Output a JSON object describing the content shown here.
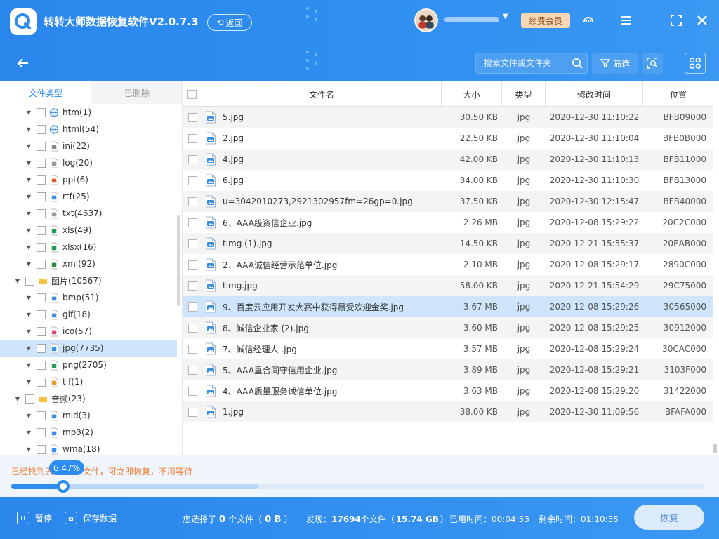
{
  "header": {
    "title": "转转大师数据恢复软件V2.0.7.3",
    "back_label": "返回",
    "vip_label": "续费会员"
  },
  "toolbar": {
    "search_placeholder": "搜索文件或文件夹",
    "filter_label": "筛选"
  },
  "sidebar": {
    "tabs": [
      {
        "label": "文件类型",
        "active": true
      },
      {
        "label": "已删除",
        "active": false
      }
    ],
    "tree": [
      {
        "level": 2,
        "label": "htm",
        "count": "(1)",
        "icon": "web-icon"
      },
      {
        "level": 2,
        "label": "html",
        "count": "(54)",
        "icon": "web-icon"
      },
      {
        "level": 2,
        "label": "ini",
        "count": "(22)",
        "icon": "config-file-icon"
      },
      {
        "level": 2,
        "label": "log",
        "count": "(20)",
        "icon": "text-file-icon"
      },
      {
        "level": 2,
        "label": "ppt",
        "count": "(6)",
        "icon": "ppt-file-icon"
      },
      {
        "level": 2,
        "label": "rtf",
        "count": "(25)",
        "icon": "rtf-file-icon"
      },
      {
        "level": 2,
        "label": "txt",
        "count": "(4637)",
        "icon": "text-file-icon"
      },
      {
        "level": 2,
        "label": "xls",
        "count": "(49)",
        "icon": "excel-file-icon"
      },
      {
        "level": 2,
        "label": "xlsx",
        "count": "(16)",
        "icon": "excel-file-icon"
      },
      {
        "level": 2,
        "label": "xml",
        "count": "(92)",
        "icon": "xml-file-icon"
      },
      {
        "level": 1,
        "label": "图片",
        "count": "(10567)",
        "icon": "folder-icon"
      },
      {
        "level": 2,
        "label": "bmp",
        "count": "(51)",
        "icon": "image-file-icon"
      },
      {
        "level": 2,
        "label": "gif",
        "count": "(18)",
        "icon": "image-file-icon"
      },
      {
        "level": 2,
        "label": "ico",
        "count": "(57)",
        "icon": "ico-file-icon"
      },
      {
        "level": 2,
        "label": "jpg",
        "count": "(7735)",
        "icon": "image-file-icon",
        "selected": true
      },
      {
        "level": 2,
        "label": "png",
        "count": "(2705)",
        "icon": "png-file-icon"
      },
      {
        "level": 2,
        "label": "tif",
        "count": "(1)",
        "icon": "tif-file-icon"
      },
      {
        "level": 1,
        "label": "音频",
        "count": "(23)",
        "icon": "folder-icon"
      },
      {
        "level": 2,
        "label": "mid",
        "count": "(3)",
        "icon": "audio-file-icon"
      },
      {
        "level": 2,
        "label": "mp3",
        "count": "(2)",
        "icon": "audio-file-icon"
      },
      {
        "level": 2,
        "label": "wma",
        "count": "(18)",
        "icon": "audio-file-icon"
      }
    ]
  },
  "table": {
    "columns": [
      "文件名",
      "大小",
      "类型",
      "修改时间",
      "位置"
    ],
    "rows": [
      {
        "name": "5.jpg",
        "size": "30.50 KB",
        "type": "jpg",
        "time": "2020-12-30 11:10:22",
        "location": "BFB09000"
      },
      {
        "name": "2.jpg",
        "size": "22.50 KB",
        "type": "jpg",
        "time": "2020-12-30 11:10:04",
        "location": "BFB0B000"
      },
      {
        "name": "4.jpg",
        "size": "42.00 KB",
        "type": "jpg",
        "time": "2020-12-30 11:10:13",
        "location": "BFB11000"
      },
      {
        "name": "6.jpg",
        "size": "34.00 KB",
        "type": "jpg",
        "time": "2020-12-30 11:10:30",
        "location": "BFB13000"
      },
      {
        "name": "u=3042010273,2921302957fm=26gp=0.jpg",
        "size": "37.50 KB",
        "type": "jpg",
        "time": "2020-12-30 12:15:47",
        "location": "BFB40000"
      },
      {
        "name": "6、AAA级资信企业.jpg",
        "size": "2.26 MB",
        "type": "jpg",
        "time": "2020-12-08 15:29:22",
        "location": "20C2C000"
      },
      {
        "name": "timg (1).jpg",
        "size": "14.50 KB",
        "type": "jpg",
        "time": "2020-12-21 15:55:37",
        "location": "20EAB000"
      },
      {
        "name": "2、AAA诚信经营示范单位.jpg",
        "size": "2.10 MB",
        "type": "jpg",
        "time": "2020-12-08 15:29:17",
        "location": "2890C000"
      },
      {
        "name": "timg.jpg",
        "size": "58.00 KB",
        "type": "jpg",
        "time": "2020-12-21 15:54:29",
        "location": "29C75000"
      },
      {
        "name": "9、百度云应用开发大赛中获得最受欢迎金奖.jpg",
        "size": "3.67 MB",
        "type": "jpg",
        "time": "2020-12-08 15:29:26",
        "location": "30565000",
        "selected": true
      },
      {
        "name": "8、诚信企业家 (2).jpg",
        "size": "3.60 MB",
        "type": "jpg",
        "time": "2020-12-08 15:29:25",
        "location": "30912000"
      },
      {
        "name": "7、诚信经理人 .jpg",
        "size": "3.57 MB",
        "type": "jpg",
        "time": "2020-12-08 15:29:24",
        "location": "30CAC000"
      },
      {
        "name": "5、AAA重合同守信用企业.jpg",
        "size": "3.89 MB",
        "type": "jpg",
        "time": "2020-12-08 15:29:21",
        "location": "3103F000"
      },
      {
        "name": "4、AAA质量服务诚信单位.jpg",
        "size": "3.63 MB",
        "type": "jpg",
        "time": "2020-12-08 15:29:20",
        "location": "31422000"
      },
      {
        "name": "1.jpg",
        "size": "38.00 KB",
        "type": "jpg",
        "time": "2020-12-30 11:09:56",
        "location": "BFAFA000"
      }
    ]
  },
  "progress": {
    "message_prefix": "已经找到丢",
    "message_suffix": "文件，可立即恢复，不用等待",
    "percent_label": "6.47%",
    "percent": 0.0647
  },
  "footer": {
    "pause_label": "暂停",
    "save_label": "保存数据",
    "selected_prefix": "您选择了",
    "selected_count": "0",
    "selected_unit": "个文件（",
    "selected_size": "0 B",
    "selected_close": "）",
    "found_prefix": "发现：",
    "found_count": "17694",
    "found_unit": "个文件（",
    "found_size": "15.74 GB",
    "found_close": "）",
    "elapsed_label": "已用时间：",
    "elapsed_value": "00:04:53",
    "remaining_label": "剩余时间：",
    "remaining_value": "01:10:35",
    "recover_label": "恢复"
  },
  "colors": {
    "brand": "#2d8cf0",
    "selected_row": "#cfe5fc",
    "warning_text": "#f07c30",
    "vip": "#f7d7b4"
  }
}
